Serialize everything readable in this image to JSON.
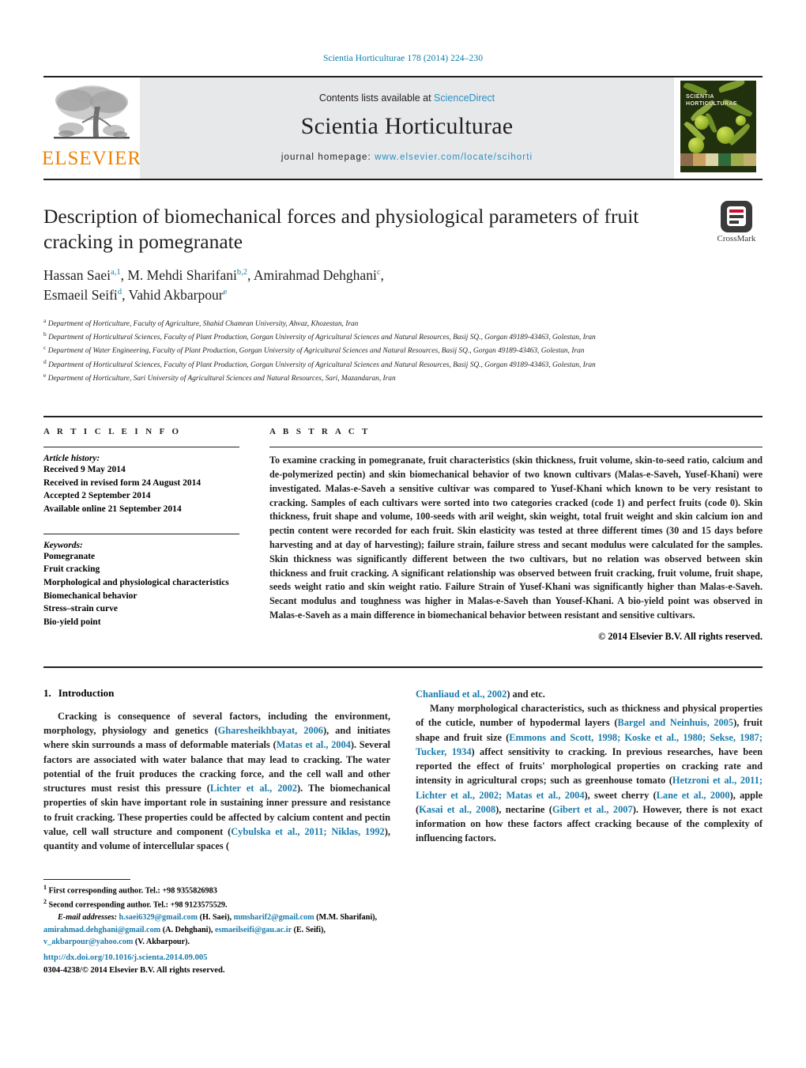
{
  "running_head": "Scientia Horticulturae 178 (2014) 224–230",
  "masthead": {
    "contents_prefix": "Contents lists available at ",
    "contents_link": "ScienceDirect",
    "journal_title": "Scientia Horticulturae",
    "homepage_label": "journal homepage:",
    "homepage_url": "www.elsevier.com/locate/scihorti",
    "publisher_wordmark": "ELSEVIER",
    "cover_title_line1": "SCIENTIA",
    "cover_title_line2": "HORTICULTURAE",
    "accent_orange": "#EF8200",
    "accent_blue": "#1A7CAB",
    "banner_bg": "#E7E8E9"
  },
  "crossmark": {
    "label": "CrossMark"
  },
  "article": {
    "title": "Description of biomechanical forces and physiological parameters of fruit cracking in pomegranate",
    "authors": [
      {
        "name": "Hassan Saei",
        "marks": "a,1",
        "sep": ", "
      },
      {
        "name": "M. Mehdi Sharifani",
        "marks": "b,2",
        "sep": ", "
      },
      {
        "name": "Amirahmad Dehghani",
        "marks": "c",
        "sep": ","
      },
      {
        "name": "Esmaeil Seifi",
        "marks": "d",
        "sep": ", "
      },
      {
        "name": "Vahid Akbarpour",
        "marks": "e",
        "sep": ""
      }
    ],
    "affiliations": [
      {
        "mark": "a",
        "text": "Department of Horticulture, Faculty of Agriculture, Shahid Chamran University, Ahvaz, Khozestan, Iran"
      },
      {
        "mark": "b",
        "text": "Department of Horticultural Sciences, Faculty of Plant Production, Gorgan University of Agricultural Sciences and Natural Resources, Basij SQ., Gorgan 49189-43463, Golestan, Iran"
      },
      {
        "mark": "c",
        "text": "Department of Water Engineering, Faculty of Plant Production, Gorgan University of Agricultural Sciences and Natural Resources, Basij SQ., Gorgan 49189-43463, Golestan, Iran"
      },
      {
        "mark": "d",
        "text": "Department of Horticultural Sciences, Faculty of Plant Production, Gorgan University of Agricultural Sciences and Natural Resources, Basij SQ., Gorgan 49189-43463, Golestan, Iran"
      },
      {
        "mark": "e",
        "text": "Department of Horticulture, Sari University of Agricultural Sciences and Natural Resources, Sari, Mazandaran, Iran"
      }
    ]
  },
  "article_info": {
    "heading": "A R T I C L E   I N F O",
    "history_label": "Article history:",
    "history": [
      "Received 9 May 2014",
      "Received in revised form 24 August 2014",
      "Accepted 2 September 2014",
      "Available online 21 September 2014"
    ],
    "keywords_label": "Keywords:",
    "keywords": [
      "Pomegranate",
      "Fruit cracking",
      "Morphological and physiological characteristics",
      "Biomechanical behavior",
      "Stress–strain curve",
      "Bio-yield point"
    ]
  },
  "abstract": {
    "heading": "A B S T R A C T",
    "text": "To examine cracking in pomegranate, fruit characteristics (skin thickness, fruit volume, skin-to-seed ratio, calcium and de-polymerized pectin) and skin biomechanical behavior of two known cultivars (Malas-e-Saveh, Yusef-Khani) were investigated. Malas-e-Saveh a sensitive cultivar was compared to Yusef-Khani which known to be very resistant to cracking. Samples of each cultivars were sorted into two categories cracked (code 1) and perfect fruits (code 0). Skin thickness, fruit shape and volume, 100-seeds with aril weight, skin weight, total fruit weight and skin calcium ion and pectin content were recorded for each fruit. Skin elasticity was tested at three different times (30 and 15 days before harvesting and at day of harvesting); failure strain, failure stress and secant modulus were calculated for the samples. Skin thickness was significantly different between the two cultivars, but no relation was observed between skin thickness and fruit cracking. A significant relationship was observed between fruit cracking, fruit volume, fruit shape, seeds weight ratio and skin weight ratio. Failure Strain of Yusef-Khani was significantly higher than Malas-e-Saveh. Secant modulus and toughness was higher in Malas-e-Saveh than Yousef-Khani. A bio-yield point was observed in Malas-e-Saveh as a main difference in biomechanical behavior between resistant and sensitive cultivars.",
    "copyright": "© 2014 Elsevier B.V. All rights reserved."
  },
  "introduction": {
    "number": "1.",
    "heading": "Introduction",
    "paragraph1_parts": [
      {
        "t": "Cracking is consequence of several factors, including the environment, morphology, physiology and genetics (",
        "cit": false
      },
      {
        "t": "Gharesheikhbayat, 2006",
        "cit": true
      },
      {
        "t": "), and initiates where skin surrounds a mass of deformable materials (",
        "cit": false
      },
      {
        "t": "Matas et al., 2004",
        "cit": true
      },
      {
        "t": "). Several factors are associated with water balance that may lead to cracking. The water potential of the fruit produces the cracking force, and the cell wall and other structures must resist this pressure (",
        "cit": false
      },
      {
        "t": "Lichter et al., 2002",
        "cit": true
      },
      {
        "t": "). The biomechanical properties of skin have important role in sustaining inner pressure and resistance to fruit cracking. These properties could be affected by calcium content and pectin value, cell wall structure and component (",
        "cit": false
      },
      {
        "t": "Cybulska et al., 2011; Niklas, 1992",
        "cit": true
      },
      {
        "t": "), quantity and volume of intercellular spaces (",
        "cit": false
      },
      {
        "t": "Chanliaud et al., 2002",
        "cit": true
      },
      {
        "t": ") and etc.",
        "cit": false
      }
    ],
    "paragraph2_parts": [
      {
        "t": "Many morphological characteristics, such as thickness and physical properties of the cuticle, number of hypodermal layers (",
        "cit": false
      },
      {
        "t": "Bargel and Neinhuis, 2005",
        "cit": true
      },
      {
        "t": "), fruit shape and fruit size (",
        "cit": false
      },
      {
        "t": "Emmons and Scott, 1998; Koske et al., 1980; Sekse, 1987; Tucker, 1934",
        "cit": true
      },
      {
        "t": ") affect sensitivity to cracking. In previous researches, have been reported the effect of fruits' morphological properties on cracking rate and intensity in agricultural crops; such as greenhouse tomato (",
        "cit": false
      },
      {
        "t": "Hetzroni et al., 2011; Lichter et al., 2002; Matas et al., 2004",
        "cit": true
      },
      {
        "t": "), sweet cherry (",
        "cit": false
      },
      {
        "t": "Lane et al., 2000",
        "cit": true
      },
      {
        "t": "), apple (",
        "cit": false
      },
      {
        "t": "Kasai et al., 2008",
        "cit": true
      },
      {
        "t": "), nectarine (",
        "cit": false
      },
      {
        "t": "Gibert et al., 2007",
        "cit": true
      },
      {
        "t": "). However, there is not exact information on how these factors affect cracking because of the complexity of influencing factors.",
        "cit": false
      }
    ]
  },
  "footnotes": {
    "note1_mark": "1",
    "note1": "First corresponding author. Tel.: +98 9355826983",
    "note2_mark": "2",
    "note2": "Second corresponding author. Tel.: +98 9123575529.",
    "email_label": "E-mail addresses:",
    "emails": [
      {
        "addr": "h.saei6329@gmail.com",
        "who": " (H. Saei), "
      },
      {
        "addr": "mmsharif2@gmail.com",
        "who": " (M.M. Sharifani), "
      },
      {
        "addr": "amirahmad.dehghani@gmail.com",
        "who": " (A. Dehghani), "
      },
      {
        "addr": "esmaeilseifi@gau.ac.ir",
        "who": " (E. Seifi), "
      },
      {
        "addr": "v_akbarpour@yahoo.com",
        "who": " (V. Akbarpour)."
      }
    ]
  },
  "doi_block": {
    "doi": "http://dx.doi.org/10.1016/j.scienta.2014.09.005",
    "issn_line": "0304-4238/© 2014 Elsevier B.V. All rights reserved."
  }
}
